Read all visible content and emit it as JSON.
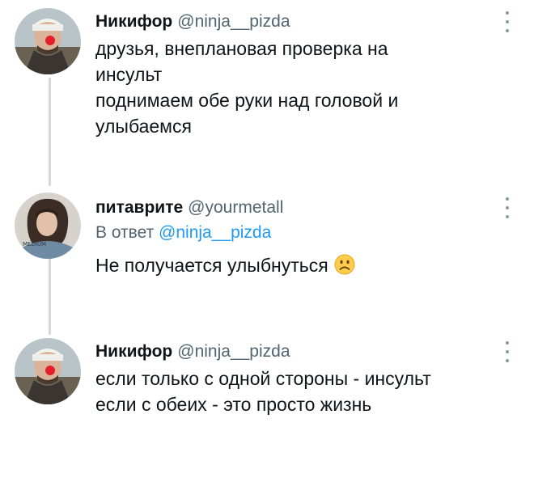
{
  "tweets": [
    {
      "name": "Никифор",
      "handle": "@ninja__pizda",
      "lines": [
        "друзья, внеплановая проверка на",
        "инсульт",
        "поднимаем обе руки над головой и",
        "улыбаемся"
      ]
    },
    {
      "name": "питаврите",
      "handle": "@yourmetall",
      "reply_prefix": "В ответ",
      "reply_handle": "@ninja__pizda",
      "text": "Не получается улыбнуться",
      "emoji": "frowning-face"
    },
    {
      "name": "Никифор",
      "handle": "@ninja__pizda",
      "lines": [
        "если только с одной стороны - инсульт",
        "если с обеих - это просто жизнь"
      ]
    }
  ],
  "colors": {
    "text": "#0f1419",
    "secondary": "#536471",
    "link": "#1d9bf0",
    "thread_line": "#cfd9de"
  }
}
